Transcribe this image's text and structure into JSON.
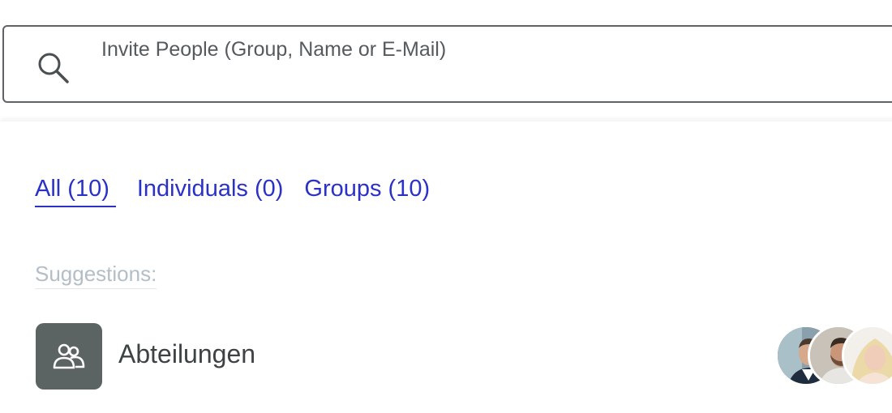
{
  "search": {
    "placeholder": "Invite People (Group, Name or E-Mail)"
  },
  "tabs": [
    {
      "label": "All (10)",
      "active": true
    },
    {
      "label": "Individuals (0)",
      "active": false
    },
    {
      "label": "Groups (10)",
      "active": false
    }
  ],
  "suggestions": {
    "label": "Suggestions:",
    "items": [
      {
        "name": "Abteilungen",
        "icon": "group-icon"
      }
    ]
  },
  "colors": {
    "link": "#2b31c7",
    "muted": "#b4bec6",
    "icon_bg": "#5c6463",
    "border": "#5f6366"
  }
}
